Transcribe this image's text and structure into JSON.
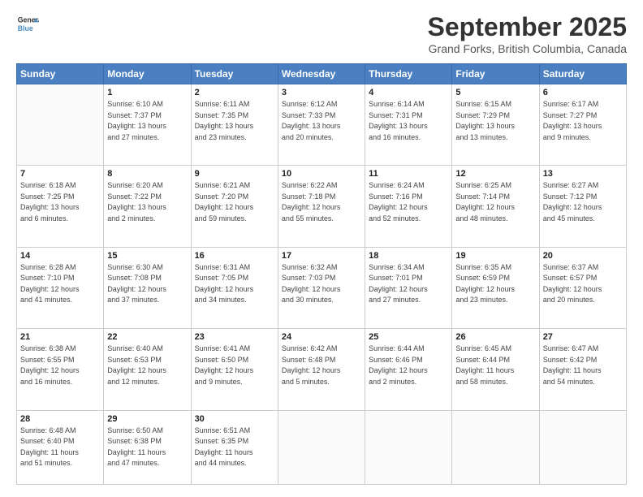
{
  "header": {
    "logo_line1": "General",
    "logo_line2": "Blue",
    "month_title": "September 2025",
    "subtitle": "Grand Forks, British Columbia, Canada"
  },
  "weekdays": [
    "Sunday",
    "Monday",
    "Tuesday",
    "Wednesday",
    "Thursday",
    "Friday",
    "Saturday"
  ],
  "weeks": [
    [
      {
        "day": "",
        "info": ""
      },
      {
        "day": "1",
        "info": "Sunrise: 6:10 AM\nSunset: 7:37 PM\nDaylight: 13 hours\nand 27 minutes."
      },
      {
        "day": "2",
        "info": "Sunrise: 6:11 AM\nSunset: 7:35 PM\nDaylight: 13 hours\nand 23 minutes."
      },
      {
        "day": "3",
        "info": "Sunrise: 6:12 AM\nSunset: 7:33 PM\nDaylight: 13 hours\nand 20 minutes."
      },
      {
        "day": "4",
        "info": "Sunrise: 6:14 AM\nSunset: 7:31 PM\nDaylight: 13 hours\nand 16 minutes."
      },
      {
        "day": "5",
        "info": "Sunrise: 6:15 AM\nSunset: 7:29 PM\nDaylight: 13 hours\nand 13 minutes."
      },
      {
        "day": "6",
        "info": "Sunrise: 6:17 AM\nSunset: 7:27 PM\nDaylight: 13 hours\nand 9 minutes."
      }
    ],
    [
      {
        "day": "7",
        "info": "Sunrise: 6:18 AM\nSunset: 7:25 PM\nDaylight: 13 hours\nand 6 minutes."
      },
      {
        "day": "8",
        "info": "Sunrise: 6:20 AM\nSunset: 7:22 PM\nDaylight: 13 hours\nand 2 minutes."
      },
      {
        "day": "9",
        "info": "Sunrise: 6:21 AM\nSunset: 7:20 PM\nDaylight: 12 hours\nand 59 minutes."
      },
      {
        "day": "10",
        "info": "Sunrise: 6:22 AM\nSunset: 7:18 PM\nDaylight: 12 hours\nand 55 minutes."
      },
      {
        "day": "11",
        "info": "Sunrise: 6:24 AM\nSunset: 7:16 PM\nDaylight: 12 hours\nand 52 minutes."
      },
      {
        "day": "12",
        "info": "Sunrise: 6:25 AM\nSunset: 7:14 PM\nDaylight: 12 hours\nand 48 minutes."
      },
      {
        "day": "13",
        "info": "Sunrise: 6:27 AM\nSunset: 7:12 PM\nDaylight: 12 hours\nand 45 minutes."
      }
    ],
    [
      {
        "day": "14",
        "info": "Sunrise: 6:28 AM\nSunset: 7:10 PM\nDaylight: 12 hours\nand 41 minutes."
      },
      {
        "day": "15",
        "info": "Sunrise: 6:30 AM\nSunset: 7:08 PM\nDaylight: 12 hours\nand 37 minutes."
      },
      {
        "day": "16",
        "info": "Sunrise: 6:31 AM\nSunset: 7:05 PM\nDaylight: 12 hours\nand 34 minutes."
      },
      {
        "day": "17",
        "info": "Sunrise: 6:32 AM\nSunset: 7:03 PM\nDaylight: 12 hours\nand 30 minutes."
      },
      {
        "day": "18",
        "info": "Sunrise: 6:34 AM\nSunset: 7:01 PM\nDaylight: 12 hours\nand 27 minutes."
      },
      {
        "day": "19",
        "info": "Sunrise: 6:35 AM\nSunset: 6:59 PM\nDaylight: 12 hours\nand 23 minutes."
      },
      {
        "day": "20",
        "info": "Sunrise: 6:37 AM\nSunset: 6:57 PM\nDaylight: 12 hours\nand 20 minutes."
      }
    ],
    [
      {
        "day": "21",
        "info": "Sunrise: 6:38 AM\nSunset: 6:55 PM\nDaylight: 12 hours\nand 16 minutes."
      },
      {
        "day": "22",
        "info": "Sunrise: 6:40 AM\nSunset: 6:53 PM\nDaylight: 12 hours\nand 12 minutes."
      },
      {
        "day": "23",
        "info": "Sunrise: 6:41 AM\nSunset: 6:50 PM\nDaylight: 12 hours\nand 9 minutes."
      },
      {
        "day": "24",
        "info": "Sunrise: 6:42 AM\nSunset: 6:48 PM\nDaylight: 12 hours\nand 5 minutes."
      },
      {
        "day": "25",
        "info": "Sunrise: 6:44 AM\nSunset: 6:46 PM\nDaylight: 12 hours\nand 2 minutes."
      },
      {
        "day": "26",
        "info": "Sunrise: 6:45 AM\nSunset: 6:44 PM\nDaylight: 11 hours\nand 58 minutes."
      },
      {
        "day": "27",
        "info": "Sunrise: 6:47 AM\nSunset: 6:42 PM\nDaylight: 11 hours\nand 54 minutes."
      }
    ],
    [
      {
        "day": "28",
        "info": "Sunrise: 6:48 AM\nSunset: 6:40 PM\nDaylight: 11 hours\nand 51 minutes."
      },
      {
        "day": "29",
        "info": "Sunrise: 6:50 AM\nSunset: 6:38 PM\nDaylight: 11 hours\nand 47 minutes."
      },
      {
        "day": "30",
        "info": "Sunrise: 6:51 AM\nSunset: 6:35 PM\nDaylight: 11 hours\nand 44 minutes."
      },
      {
        "day": "",
        "info": ""
      },
      {
        "day": "",
        "info": ""
      },
      {
        "day": "",
        "info": ""
      },
      {
        "day": "",
        "info": ""
      }
    ]
  ]
}
